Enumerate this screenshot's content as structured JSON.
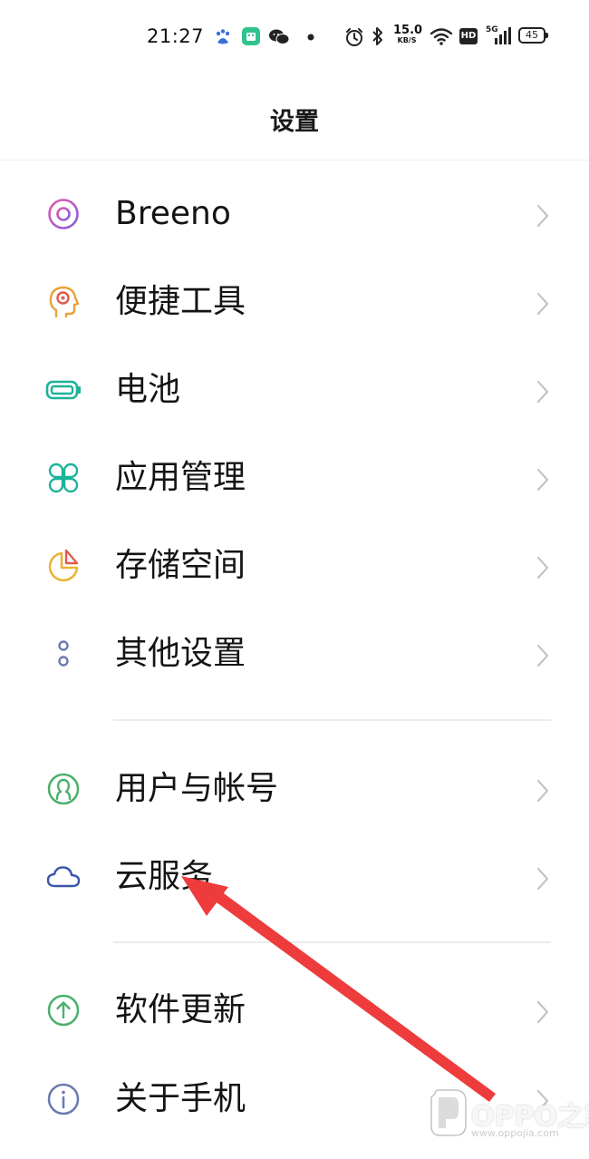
{
  "status_bar": {
    "time": "21:27",
    "net_speed_value": "15.0",
    "net_speed_unit": "KB/S",
    "hd_label": "HD",
    "signal_label": "5G",
    "battery_level": "45"
  },
  "header": {
    "title": "设置"
  },
  "settings": {
    "items": [
      {
        "label": "Breeno",
        "icon": "breeno-icon"
      },
      {
        "label": "便捷工具",
        "icon": "convenience-tools-icon"
      },
      {
        "label": "电池",
        "icon": "battery-icon"
      },
      {
        "label": "应用管理",
        "icon": "app-management-icon"
      },
      {
        "label": "存储空间",
        "icon": "storage-icon"
      },
      {
        "label": "其他设置",
        "icon": "more-settings-icon"
      },
      {
        "label": "用户与帐号",
        "icon": "user-account-icon"
      },
      {
        "label": "云服务",
        "icon": "cloud-icon"
      },
      {
        "label": "软件更新",
        "icon": "software-update-icon"
      },
      {
        "label": "关于手机",
        "icon": "about-phone-icon"
      }
    ]
  },
  "watermark": {
    "text": "OPPO之家",
    "url": "www.oppojia.com"
  },
  "colors": {
    "breeno": "#b35bd6",
    "tools": "#e8a23a",
    "battery": "#1bb39a",
    "apps": "#1bb39a",
    "storage": "#eab43a",
    "storage_accent": "#e35a4a",
    "more": "#6a7bb0",
    "user": "#4caf6e",
    "cloud": "#3c56a8",
    "update": "#4caf6e",
    "about": "#6a7bb0",
    "annotation_arrow": "#ee3b3b"
  }
}
